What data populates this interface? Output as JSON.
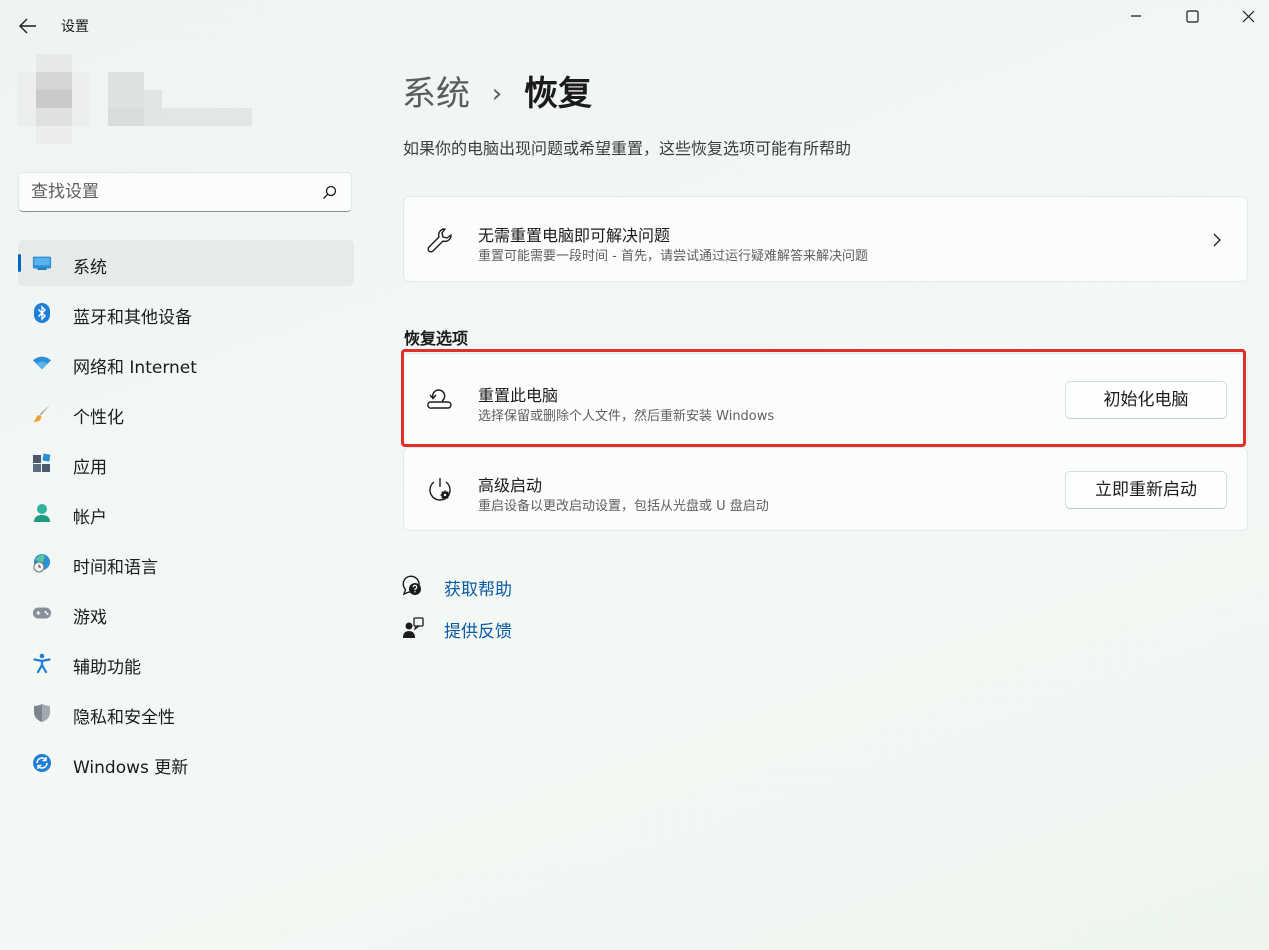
{
  "window": {
    "title": "设置"
  },
  "search": {
    "placeholder": "查找设置"
  },
  "sidebar": {
    "items": [
      {
        "label": "系统",
        "icon": "monitor-icon",
        "active": true
      },
      {
        "label": "蓝牙和其他设备",
        "icon": "bluetooth-icon"
      },
      {
        "label": "网络和 Internet",
        "icon": "wifi-icon"
      },
      {
        "label": "个性化",
        "icon": "brush-icon"
      },
      {
        "label": "应用",
        "icon": "apps-icon"
      },
      {
        "label": "帐户",
        "icon": "account-icon"
      },
      {
        "label": "时间和语言",
        "icon": "globe-clock-icon"
      },
      {
        "label": "游戏",
        "icon": "gamepad-icon"
      },
      {
        "label": "辅助功能",
        "icon": "accessibility-icon"
      },
      {
        "label": "隐私和安全性",
        "icon": "shield-icon"
      },
      {
        "label": "Windows 更新",
        "icon": "update-icon"
      }
    ]
  },
  "breadcrumb": {
    "parent": "系统",
    "separator": "›",
    "current": "恢复"
  },
  "page": {
    "description": "如果你的电脑出现问题或希望重置，这些恢复选项可能有所帮助"
  },
  "troubleshoot_card": {
    "title": "无需重置电脑即可解决问题",
    "subtitle": "重置可能需要一段时间 - 首先，请尝试通过运行疑难解答来解决问题",
    "icon": "wrench-icon"
  },
  "recovery_options": {
    "heading": "恢复选项",
    "reset": {
      "title": "重置此电脑",
      "subtitle": "选择保留或删除个人文件，然后重新安装 Windows",
      "button": "初始化电脑",
      "icon": "reset-pc-icon"
    },
    "advanced_startup": {
      "title": "高级启动",
      "subtitle": "重启设备以更改启动设置，包括从光盘或 U 盘启动",
      "button": "立即重新启动",
      "icon": "advanced-startup-icon"
    }
  },
  "links": {
    "help": "获取帮助",
    "feedback": "提供反馈"
  },
  "colors": {
    "accent": "#0067c0",
    "link": "#0a5aa6",
    "highlight_border": "#e0302a"
  }
}
